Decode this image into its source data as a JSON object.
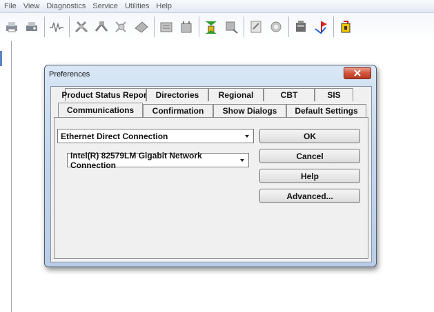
{
  "menubar": {
    "items": [
      "File",
      "View",
      "Diagnostics",
      "Service",
      "Utilities",
      "Help"
    ]
  },
  "toolbar": {
    "buttons": [
      {
        "icon": "printer-icon"
      },
      {
        "icon": "printer-setup-icon"
      },
      {
        "icon": "waveform-icon"
      },
      {
        "icon": "diagnostic-tool-1-icon"
      },
      {
        "icon": "diagnostic-tool-2-icon"
      },
      {
        "icon": "diagnostic-tool-3-icon"
      },
      {
        "icon": "diagnostic-tool-4-icon"
      },
      {
        "icon": "manual-book-icon"
      },
      {
        "icon": "module-test-icon"
      },
      {
        "icon": "connect-ecu-icon"
      },
      {
        "icon": "data-transfer-icon"
      },
      {
        "icon": "notepad-icon"
      },
      {
        "icon": "settings-gear-icon"
      },
      {
        "icon": "vehicle-icon"
      },
      {
        "icon": "flag-icon"
      },
      {
        "icon": "exit-icon"
      }
    ]
  },
  "dialog": {
    "title": "Preferences",
    "close_icon": "close-icon",
    "tabs_back": [
      "Product Status Report",
      "Directories",
      "Regional",
      "CBT",
      "SIS"
    ],
    "tabs_front": [
      "Communications",
      "Confirmation",
      "Show Dialogs",
      "Default Settings"
    ],
    "active_tab": "Communications",
    "connection_type": "Ethernet Direct Connection",
    "network_adapter": "Intel(R) 82579LM Gigabit Network Connection",
    "buttons": {
      "ok": "OK",
      "cancel": "Cancel",
      "help": "Help",
      "advanced": "Advanced..."
    }
  },
  "colors": {
    "dialog_frame": "#c4d6ec",
    "close_button": "#c9462d",
    "client_background": "#f0f0f0"
  }
}
